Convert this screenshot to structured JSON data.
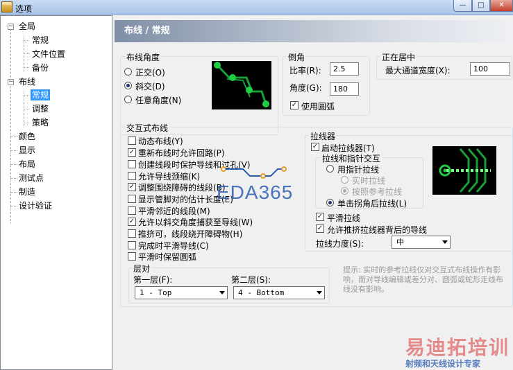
{
  "window": {
    "title": "选项",
    "app_icon_text": "PADS"
  },
  "tree": {
    "items": [
      {
        "label": "全局",
        "expander": "−"
      },
      {
        "label": "常规"
      },
      {
        "label": "文件位置"
      },
      {
        "label": "备份"
      },
      {
        "label": "布线",
        "expander": "−"
      },
      {
        "label": "常规",
        "selected": true
      },
      {
        "label": "调整"
      },
      {
        "label": "策略"
      },
      {
        "label": "颜色"
      },
      {
        "label": "显示"
      },
      {
        "label": "布局"
      },
      {
        "label": "测试点"
      },
      {
        "label": "制造"
      },
      {
        "label": "设计验证"
      }
    ]
  },
  "header": {
    "title": "布线 / 常规"
  },
  "routing_angle": {
    "legend": "布线角度",
    "options": [
      {
        "label": "正交(O)",
        "checked": false
      },
      {
        "label": "斜交(D)",
        "checked": true
      },
      {
        "label": "任意角度(N)",
        "checked": false
      }
    ]
  },
  "chamfer": {
    "legend": "倒角",
    "ratio_label": "比率(R):",
    "ratio_value": "2.5",
    "angle_label": "角度(G):",
    "angle_value": "180",
    "use_arc_label": "使用圆弧",
    "use_arc_checked": true
  },
  "centering": {
    "legend": "正在居中",
    "max_width_label": "最大通道宽度(X):",
    "max_width_value": "100"
  },
  "interactive": {
    "legend": "交互式布线",
    "options": [
      {
        "label": "动态布线(Y)",
        "checked": false
      },
      {
        "label": "重新布线时允许回路(P)",
        "checked": true
      },
      {
        "label": "创建线段时保护导线和过孔(V)",
        "checked": false
      },
      {
        "label": "允许导线颈缩(K)",
        "checked": false
      },
      {
        "label": "调整围绕障碍的线段(B)",
        "checked": true
      },
      {
        "label": "显示管脚对的估计长度(E)",
        "checked": false
      },
      {
        "label": "平滑邻近的线段(M)",
        "checked": false
      },
      {
        "label": "允许以斜交角度捕获至导线(W)",
        "checked": true
      },
      {
        "label": "推挤可，线段绕开障碍物(H)",
        "checked": false
      },
      {
        "label": "完成时平滑导线(C)",
        "checked": false
      },
      {
        "label": "平滑时保留圆弧",
        "checked": false
      }
    ]
  },
  "layers": {
    "legend": "层对",
    "first_label": "第一层(F):",
    "first_value": "1 - Top",
    "second_label": "第二层(S):",
    "second_value": "4 - Bottom"
  },
  "puller": {
    "legend": "拉线器",
    "enable_label": "启动拉线器(T)",
    "enable_checked": true,
    "sub_legend": "拉线和指针交互",
    "pointer_label": "用指针拉线",
    "pointer_checked": false,
    "realtime_label": "实时拉线",
    "realtime_checked": false,
    "reference_label": "按照参考拉线",
    "reference_checked": true,
    "click_corner_label": "单击拐角后拉线(L)",
    "click_corner_checked": true,
    "smooth_label": "平滑拉线",
    "smooth_checked": true,
    "allow_push_label": "允许推挤拉线器背后的导线",
    "allow_push_checked": true,
    "force_label": "拉线力度(S):",
    "force_value": "中"
  },
  "hint_text": "提示: 实时的参考拉线仅对交互式布线操作有影响，而对导线编辑或差分对、圆弧或蛇形走线布线没有影响。",
  "watermarks": {
    "eda_text": "EDA365",
    "site_text": "易迪拓培训",
    "site_sub": "射频和天线设计专家"
  },
  "colors": {
    "trace": "#1a9e3a",
    "pad": "#22cc44",
    "header_grad": "#7f8fa6"
  }
}
